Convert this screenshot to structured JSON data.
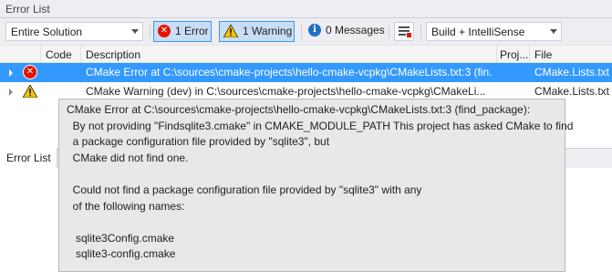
{
  "window": {
    "title": "Error List"
  },
  "toolbar": {
    "scope_value": "Entire Solution",
    "errors_label": "1 Error",
    "warnings_label": "1 Warning",
    "messages_label": "0 Messages",
    "source_value": "Build + IntelliSense"
  },
  "columns": {
    "code": "Code",
    "description": "Description",
    "project": "Proj...",
    "file": "File"
  },
  "rows": [
    {
      "severity": "error",
      "description": "CMake Error at C:\\sources\\cmake-projects\\hello-cmake-vcpkg\\CMakeLists.txt:3 (fin...",
      "file": "CMake.Lists.txt"
    },
    {
      "severity": "warning",
      "description": "CMake Warning (dev) in C:\\sources\\cmake-projects\\hello-cmake-vcpkg\\CMakeLi...",
      "file": "CMake.Lists.txt"
    }
  ],
  "tooltip": {
    "lines": [
      "CMake Error at C:\\sources\\cmake-projects\\hello-cmake-vcpkg\\CMakeLists.txt:3 (find_package):",
      "  By not providing \"Findsqlite3.cmake\" in CMAKE_MODULE_PATH This project has asked CMake to find",
      "  a package configuration file provided by \"sqlite3\", but",
      "  CMake did not find one.",
      "",
      "  Could not find a package configuration file provided by \"sqlite3\" with any",
      "  of the following names:",
      "",
      "   sqlite3Config.cmake",
      "   sqlite3-config.cmake"
    ]
  },
  "bottom_tabs": {
    "error_list": "Error List"
  },
  "colors": {
    "selection": "#3399ff",
    "error": "#e51400",
    "warning": "#f5c400",
    "info": "#1e6fc8"
  }
}
